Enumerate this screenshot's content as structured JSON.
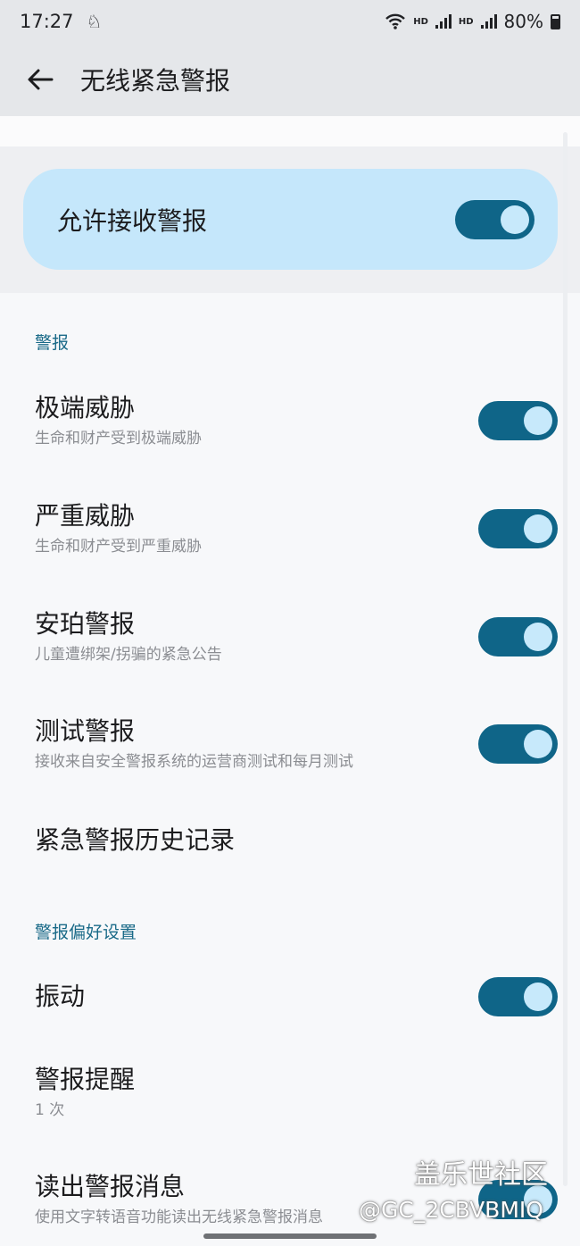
{
  "status_bar": {
    "time": "17:27",
    "hd1": "HD",
    "hd2": "HD",
    "battery": "80%"
  },
  "app_bar": {
    "title": "无线紧急警报",
    "back_icon": "arrow-left-icon"
  },
  "master": {
    "label": "允许接收警报",
    "enabled": true
  },
  "sections": {
    "alerts": "警报",
    "preferences": "警报偏好设置"
  },
  "alerts": [
    {
      "title": "极端威胁",
      "subtitle": "生命和财产受到极端威胁",
      "enabled": true
    },
    {
      "title": "严重威胁",
      "subtitle": "生命和财产受到严重威胁",
      "enabled": true
    },
    {
      "title": "安珀警报",
      "subtitle": "儿童遭绑架/拐骗的紧急公告",
      "enabled": true
    },
    {
      "title": "测试警报",
      "subtitle": "接收来自安全警报系统的运营商测试和每月测试",
      "enabled": true
    }
  ],
  "history": {
    "title": "紧急警报历史记录"
  },
  "preferences": {
    "vibration": {
      "title": "振动",
      "enabled": true
    },
    "reminder": {
      "title": "警报提醒",
      "value": "1 次"
    },
    "speak": {
      "title": "读出警报消息",
      "subtitle": "使用文字转语音功能读出无线紧急警报消息",
      "enabled": true
    }
  },
  "watermark": {
    "line1": "盖乐世社区",
    "line2": "@GC_2CBVBMIQ"
  },
  "colors": {
    "accent": "#0f6588",
    "master_card": "#c5e7fb",
    "section_header": "#1a6a88"
  }
}
